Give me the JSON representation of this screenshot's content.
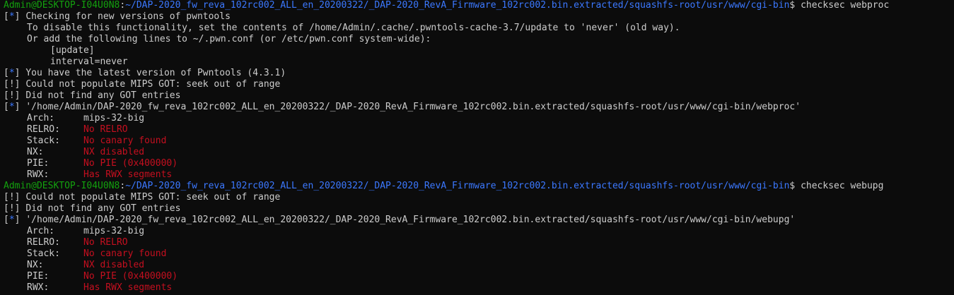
{
  "prompt1": {
    "user": "Admin@DESKTOP-I04U0N8",
    "sep": ":",
    "path": "~/DAP-2020_fw_reva_102rc002_ALL_en_20200322/_DAP-2020_RevA_Firmware_102rc002.bin.extracted/squashfs-root/usr/www/cgi-bin",
    "dollar": "$",
    "command": "checksec webproc"
  },
  "info_lines": {
    "checking": "Checking for new versions of pwntools",
    "disable": "To disable this functionality, set the contents of /home/Admin/.cache/.pwntools-cache-3.7/update to 'never' (old way).",
    "or_add": "Or add the following lines to ~/.pwn.conf (or /etc/pwn.conf system-wide):",
    "update": "[update]",
    "interval": "interval=never",
    "latest": "You have the latest version of Pwntools (4.3.1)"
  },
  "markers": {
    "star": "*",
    "bang": "!",
    "open": "[",
    "close": "]"
  },
  "warn1": {
    "mips": "Could not populate MIPS GOT: seek out of range",
    "got": "Did not find any GOT entries"
  },
  "binary1": {
    "path": "'/home/Admin/DAP-2020_fw_reva_102rc002_ALL_en_20200322/_DAP-2020_RevA_Firmware_102rc002.bin.extracted/squashfs-root/usr/www/cgi-bin/webproc'",
    "arch_key": "Arch:",
    "arch_val": "mips-32-big",
    "relro_key": "RELRO:",
    "relro_val": "No RELRO",
    "stack_key": "Stack:",
    "stack_val": "No canary found",
    "nx_key": "NX:",
    "nx_val": "NX disabled",
    "pie_key": "PIE:",
    "pie_val": "No PIE (0x400000)",
    "rwx_key": "RWX:",
    "rwx_val": "Has RWX segments"
  },
  "prompt2": {
    "user": "Admin@DESKTOP-I04U0N8",
    "sep": ":",
    "path": "~/DAP-2020_fw_reva_102rc002_ALL_en_20200322/_DAP-2020_RevA_Firmware_102rc002.bin.extracted/squashfs-root/usr/www/cgi-bin",
    "dollar": "$",
    "command": "checksec webupg"
  },
  "warn2": {
    "mips": "Could not populate MIPS GOT: seek out of range",
    "got": "Did not find any GOT entries"
  },
  "binary2": {
    "path": "'/home/Admin/DAP-2020_fw_reva_102rc002_ALL_en_20200322/_DAP-2020_RevA_Firmware_102rc002.bin.extracted/squashfs-root/usr/www/cgi-bin/webupg'",
    "arch_key": "Arch:",
    "arch_val": "mips-32-big",
    "relro_key": "RELRO:",
    "relro_val": "No RELRO",
    "stack_key": "Stack:",
    "stack_val": "No canary found",
    "nx_key": "NX:",
    "nx_val": "NX disabled",
    "pie_key": "PIE:",
    "pie_val": "No PIE (0x400000)",
    "rwx_key": "RWX:",
    "rwx_val": "Has RWX segments"
  },
  "colors": {
    "background": "#0c0c0c",
    "prompt_user": "#13a10e",
    "prompt_path": "#3b78ff",
    "warning_red": "#c50f1f",
    "text": "#cccccc"
  }
}
